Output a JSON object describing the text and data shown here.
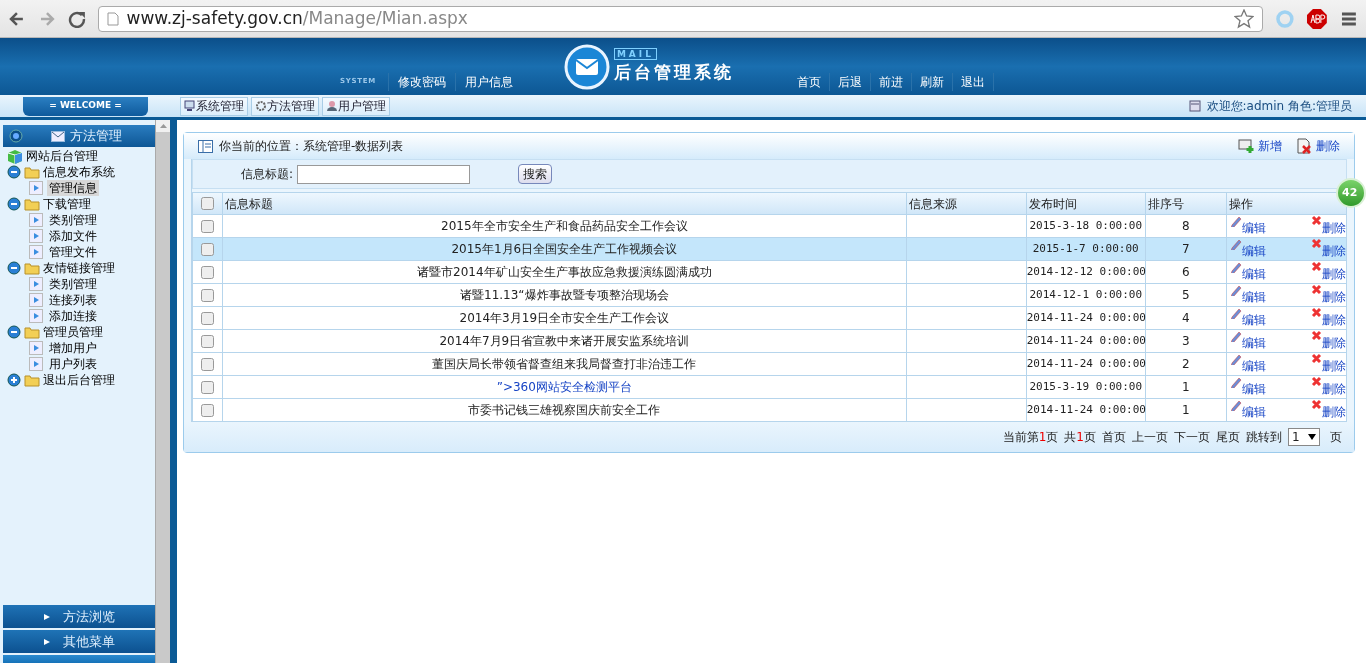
{
  "browser": {
    "url_host": "www.zj-safety.gov.cn",
    "url_path": "/Manage/Mian.aspx"
  },
  "header": {
    "system_label": "SYSTEM",
    "left_nav": [
      "修改密码",
      "用户信息"
    ],
    "logo_small": "MAIL",
    "title": "后台管理系统",
    "right_nav": [
      "首页",
      "后退",
      "前进",
      "刷新",
      "退出"
    ]
  },
  "subbar": {
    "welcome": "= WELCOME =",
    "tabs": [
      "系统管理",
      "方法管理",
      "用户管理"
    ],
    "user_info": "欢迎您:admin 角色:管理员"
  },
  "sidebar": {
    "title": "方法管理",
    "root": "网站后台管理",
    "tree": [
      {
        "label": "信息发布系统",
        "expanded": true,
        "children": [
          {
            "label": "管理信息",
            "selected": true
          }
        ]
      },
      {
        "label": "下载管理",
        "expanded": true,
        "children": [
          {
            "label": "类别管理",
            "selected": false
          },
          {
            "label": "添加文件",
            "selected": false
          },
          {
            "label": "管理文件",
            "selected": false
          }
        ]
      },
      {
        "label": "友情链接管理",
        "expanded": true,
        "children": [
          {
            "label": "类别管理",
            "selected": false
          },
          {
            "label": "连接列表",
            "selected": false
          },
          {
            "label": "添加连接",
            "selected": false
          }
        ]
      },
      {
        "label": "管理员管理",
        "expanded": true,
        "children": [
          {
            "label": "增加用户",
            "selected": false
          },
          {
            "label": "用户列表",
            "selected": false
          }
        ]
      },
      {
        "label": "退出后台管理",
        "expanded": false
      }
    ],
    "bottom_menus": [
      "方法浏览",
      "其他菜单"
    ]
  },
  "panel": {
    "breadcrumb": "你当前的位置：系统管理-数据列表",
    "actions": [
      {
        "kind": "add",
        "label": "新增"
      },
      {
        "kind": "delete",
        "label": "删除"
      }
    ],
    "search": {
      "label": "信息标题:",
      "button": "搜索"
    },
    "table": {
      "columns": [
        "信息标题",
        "信息来源",
        "发布时间",
        "排序号",
        "操作"
      ],
      "header_checked": false,
      "rows": [
        {
          "title": "2015年全市安全生产和食品药品安全工作会议",
          "kind": "text",
          "time": "2015-3-18 0:00:00",
          "order": "8",
          "selected": false,
          "checked": false
        },
        {
          "title": "2015年1月6日全国安全生产工作视频会议",
          "kind": "text",
          "time": "2015-1-7 0:00:00",
          "order": "7",
          "selected": true,
          "checked": false
        },
        {
          "title": "诸暨市2014年矿山安全生产事故应急救援演练圆满成功",
          "kind": "text",
          "time": "2014-12-12 0:00:00",
          "order": "6",
          "selected": false,
          "checked": false
        },
        {
          "title": "诸暨11.13“爆炸事故暨专项整治现场会",
          "kind": "text",
          "time": "2014-12-1 0:00:00",
          "order": "5",
          "selected": false,
          "checked": false
        },
        {
          "title": "2014年3月19日全市安全生产工作会议",
          "kind": "text",
          "time": "2014-11-24 0:00:00",
          "order": "4",
          "selected": false,
          "checked": false
        },
        {
          "title": "2014年7月9日省宣教中来诸开展安监系统培训",
          "kind": "text",
          "time": "2014-11-24 0:00:00",
          "order": "3",
          "selected": false,
          "checked": false
        },
        {
          "title": "董国庆局长带领省督查组来我局督查打非治违工作",
          "kind": "text",
          "time": "2014-11-24 0:00:00",
          "order": "2",
          "selected": false,
          "checked": false
        },
        {
          "title": "”>360网站安全检测平台",
          "kind": "link",
          "time": "2015-3-19 0:00:00",
          "order": "1",
          "selected": false,
          "checked": false
        },
        {
          "title": "市委书记钱三雄视察国庆前安全工作",
          "kind": "text",
          "time": "2014-11-24 0:00:00",
          "order": "1",
          "selected": false,
          "checked": false
        }
      ],
      "row_actions": [
        [
          "编辑",
          "删除"
        ],
        [
          "编辑",
          "删除"
        ],
        [
          "编辑",
          "删除"
        ],
        [
          "编辑",
          "删除"
        ],
        [
          "编辑",
          "删除"
        ],
        [
          "编辑",
          "删除"
        ],
        [
          "编辑",
          "删除"
        ],
        [
          "编辑",
          "删除"
        ],
        [
          "编辑",
          "删除"
        ]
      ]
    },
    "pager": {
      "current_prefix": "当前第",
      "current": "1",
      "current_suffix": "页",
      "total_prefix": "共",
      "total": "1",
      "total_suffix": "页",
      "links": [
        "首页",
        "上一页",
        "下一页",
        "尾页"
      ],
      "jump_label": "跳转到",
      "jump_value": "1",
      "jump_suffix": "页"
    }
  },
  "float_badge": "42"
}
